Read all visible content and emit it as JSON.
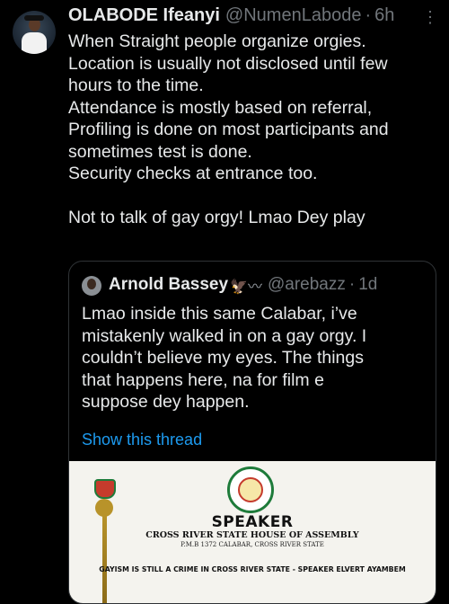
{
  "tweet": {
    "author_name": "OLABODE Ifeanyi",
    "handle": "@NumenLabode",
    "separator": "·",
    "time": "6h",
    "more_icon": "⋮",
    "lines": [
      "When Straight people organize orgies.",
      "Location is usually not disclosed until few",
      "hours to the time.",
      "Attendance is mostly based on referral,",
      "Profiling is done on most participants and",
      "sometimes test is done.",
      "Security checks at entrance too.",
      "",
      "Not to talk of gay orgy! Lmao Dey play"
    ]
  },
  "quoted": {
    "author_name": "Arnold Bassey",
    "emoji": "🦅〰",
    "handle": "@arebazz",
    "separator": "·",
    "time": "1d",
    "lines": [
      "Lmao inside this same Calabar, i’ve",
      "mistakenly walked in on a gay orgy. I",
      "couldn’t believe my eyes. The things",
      "that happens here, na for film e",
      "suppose dey happen."
    ],
    "show_thread": "Show this thread",
    "image": {
      "title": "SPEAKER",
      "subtitle": "CROSS RIVER STATE HOUSE OF ASSEMBLY",
      "address": "P.M.B 1372 CALABAR, CROSS RIVER STATE",
      "caption": "GAYISM IS STILL A CRIME IN CROSS RIVER STATE - SPEAKER ELVERT AYAMBEM"
    }
  },
  "colors": {
    "background": "#000000",
    "text": "#e7e9ea",
    "muted": "#71767b",
    "link": "#1d9bf0",
    "border": "#2f3336"
  }
}
